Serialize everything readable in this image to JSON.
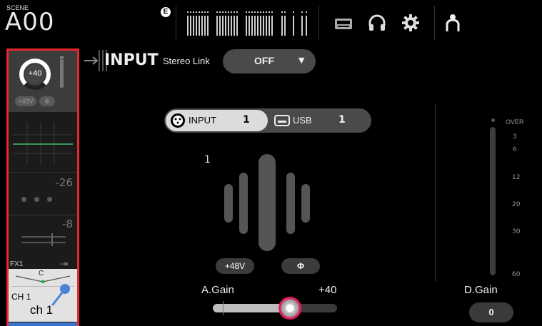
{
  "top_bar": {
    "scene_label": "SCENE",
    "scene_name": "A00",
    "ext_indicator": "E",
    "icons": [
      "usb-storage-icon",
      "headphones-icon",
      "gear-icon",
      "user-icon"
    ]
  },
  "channel_strip": {
    "gain_value": "+40",
    "phantom_label": "+48V",
    "phase_label": "Φ",
    "comp_value": "-26",
    "gate_value": "-8",
    "fx_label": "FX1",
    "fx_value": "-∞",
    "pan_label": "C",
    "channel_number": "CH 1",
    "channel_name": "ch 1",
    "highlight_color": "#e8282e"
  },
  "input_panel": {
    "title": "INPUT",
    "stereo_link_label": "Stereo Link",
    "stereo_link_value": "OFF",
    "source_input_label": "INPUT",
    "source_input_number": "1",
    "source_usb_label": "USB",
    "source_usb_number": "1",
    "channel_index": "1",
    "phantom_button": "+48V",
    "phase_button": "Φ",
    "analog_gain_label": "A.Gain",
    "analog_gain_value": "+40",
    "analog_gain_level": 0.62
  },
  "digital_gain": {
    "scale": [
      "OVER",
      "3",
      "6",
      "12",
      "20",
      "30",
      "60"
    ],
    "label": "D.Gain",
    "value": "0"
  }
}
